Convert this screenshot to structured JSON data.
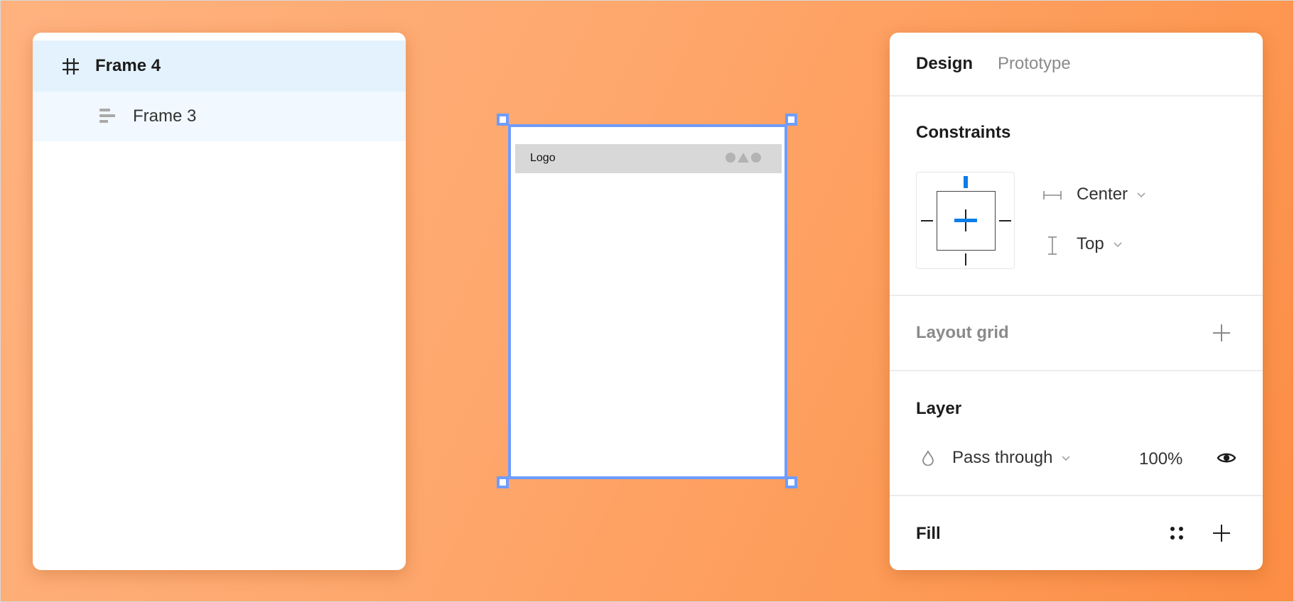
{
  "layers": {
    "items": [
      {
        "label": "Frame 4",
        "icon": "frame-hash-icon",
        "selected": true
      },
      {
        "label": "Frame 3",
        "icon": "auto-layout-icon",
        "selected": false
      }
    ]
  },
  "canvas": {
    "frame": {
      "header_logo": "Logo",
      "header_shapes": [
        "circle",
        "triangle",
        "circle"
      ]
    },
    "selection_color": "#6f9cff"
  },
  "design_panel": {
    "tabs": [
      {
        "label": "Design",
        "active": true
      },
      {
        "label": "Prototype",
        "active": false
      }
    ],
    "constraints": {
      "title": "Constraints",
      "horizontal": {
        "icon": "horizontal-constraint-icon",
        "value": "Center"
      },
      "vertical": {
        "icon": "vertical-constraint-icon",
        "value": "Top"
      },
      "accent": "#0d7de8"
    },
    "layout_grid": {
      "title": "Layout grid",
      "add_icon": "plus-icon"
    },
    "layer": {
      "title": "Layer",
      "blend_icon": "drop-icon",
      "blend_mode": "Pass through",
      "opacity": "100%",
      "visibility_icon": "eye-icon"
    },
    "fill": {
      "title": "Fill",
      "styles_icon": "styles-dots-icon",
      "add_icon": "plus-icon"
    }
  }
}
